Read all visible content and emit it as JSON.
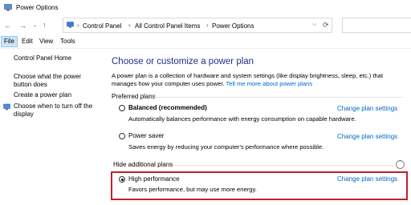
{
  "window": {
    "title": "Power Options"
  },
  "address": {
    "breadcrumbs": [
      "Control Panel",
      "All Control Panel Items",
      "Power Options"
    ]
  },
  "menu": {
    "items": [
      "File",
      "Edit",
      "View",
      "Tools"
    ]
  },
  "sidebar": {
    "items": [
      "Control Panel Home",
      "Choose what the power button does",
      "Create a power plan",
      "Choose when to turn off the display"
    ]
  },
  "main": {
    "title": "Choose or customize a power plan",
    "description": "A power plan is a collection of hardware and system settings (like display brightness, sleep, etc.) that manages how your computer uses power.",
    "tell_me_more": "Tell me more about power plans",
    "preferred_label": "Preferred plans",
    "hide_label": "Hide additional plans",
    "change_label": "Change plan settings",
    "plans": [
      {
        "name": "Balanced (recommended)",
        "desc": "Automatically balances performance with energy consumption on capable hardware.",
        "selected": false
      },
      {
        "name": "Power saver",
        "desc": "Saves energy by reducing your computer's performance where possible.",
        "selected": false
      },
      {
        "name": "High performance",
        "desc": "Favors performance, but may use more energy.",
        "selected": true
      }
    ]
  },
  "colors": {
    "highlight": "#c0202a",
    "link": "#0066cc",
    "title": "#1e3287"
  }
}
